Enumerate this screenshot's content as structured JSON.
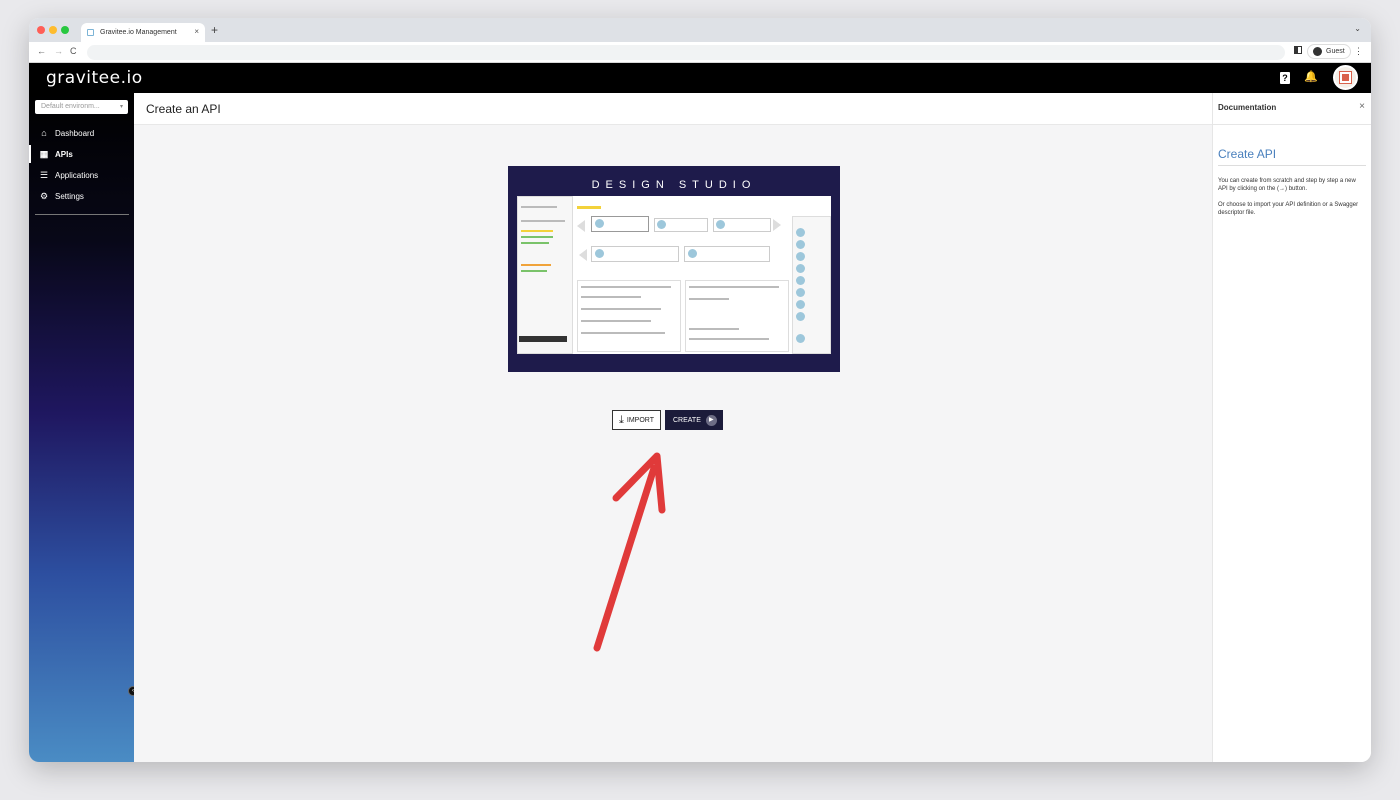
{
  "browser": {
    "tab_title": "Gravitee.io Management",
    "new_tab": "+",
    "tab_close": "×",
    "profile_label": "Guest",
    "nav": {
      "back": "←",
      "forward": "→",
      "reload": "C"
    }
  },
  "app": {
    "logo": "gravitee.io",
    "header_icons": [
      "help-icon",
      "bell-icon",
      "avatar"
    ]
  },
  "sidebar": {
    "environment_select": "Default environm...",
    "items": [
      {
        "label": "Dashboard",
        "icon": "home-icon",
        "glyph": "🏠"
      },
      {
        "label": "APIs",
        "icon": "dashboard-icon",
        "glyph": "▦",
        "active": true
      },
      {
        "label": "Applications",
        "icon": "list-icon",
        "glyph": "☰"
      },
      {
        "label": "Settings",
        "icon": "gear-icon",
        "glyph": "⚙"
      }
    ]
  },
  "main": {
    "title": "Create an API",
    "banner_title": "DESIGN STUDIO",
    "import_label": "IMPORT",
    "create_label": "CREATE"
  },
  "docs": {
    "header": "Documentation",
    "heading": "Create API",
    "paragraphs": [
      "You can create from scratch and step by step a new API by clicking on the (→) button.",
      "Or choose to import your API definition or a Swagger descriptor file."
    ]
  },
  "colors": {
    "app_header": "#000000",
    "primary_button": "#1b1b3a",
    "banner_bg": "#1e1b4b",
    "doc_heading": "#4a80bd",
    "annotation_arrow": "#e03a3a"
  }
}
